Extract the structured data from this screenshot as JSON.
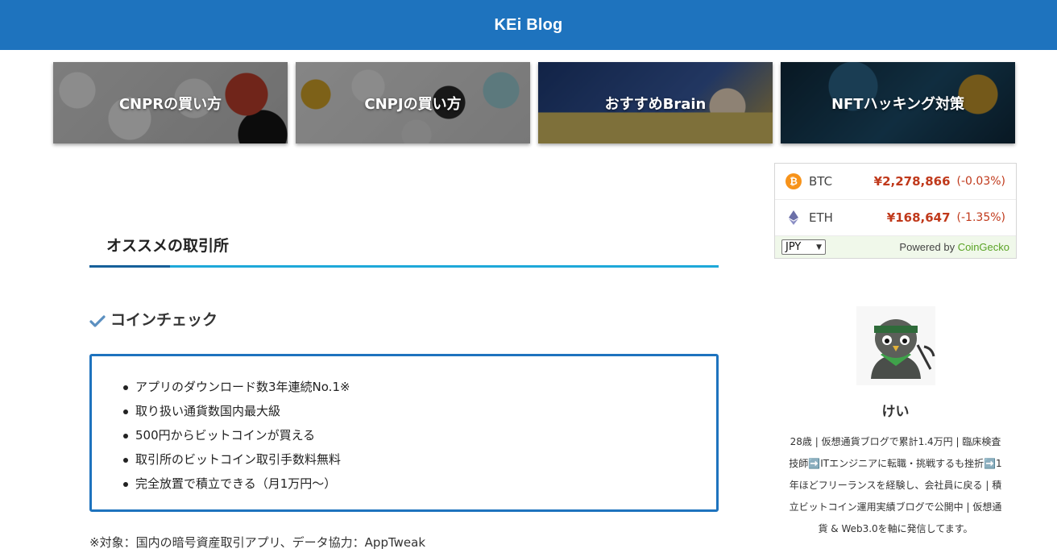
{
  "header": {
    "site_title": "KEi Blog"
  },
  "nav_cards": [
    {
      "label": "CNPRの買い方"
    },
    {
      "label": "CNPJの買い方"
    },
    {
      "label": "おすすめBrain"
    },
    {
      "label": "NFTハッキング対策"
    }
  ],
  "article": {
    "section_title": "オススメの取引所",
    "exchange_title": "コインチェック",
    "features": [
      "アプリのダウンロード数3年連続No.1※",
      "取り扱い通貨数国内最大級",
      "500円からビットコインが買える",
      "取引所のビットコイン取引手数料無料",
      "完全放置で積立できる（月1万円〜）"
    ],
    "note": "※対象：国内の暗号資産取引アプリ、データ協力：AppTweak"
  },
  "crypto_widget": {
    "coins": [
      {
        "icon": "bitcoin-icon",
        "symbol": "BTC",
        "price": "¥2,278,866",
        "change": "(-0.03%)"
      },
      {
        "icon": "ethereum-icon",
        "symbol": "ETH",
        "price": "¥168,647",
        "change": "(-1.35%)"
      }
    ],
    "currency": "JPY",
    "powered_by": "Powered by ",
    "powered_brand": "CoinGecko"
  },
  "profile": {
    "name": "けい",
    "bio": "28歳 | 仮想通貨ブログで累計1.4万円 | 臨床検査技師➡️ITエンジニアに転職・挑戦するも挫折➡️1年ほどフリーランスを経験し、会社員に戻る | 積立ビットコイン運用実績ブログで公開中 | 仮想通貨 & Web3.0を軸に発信してます。"
  },
  "colors": {
    "header_bg": "#1e73be",
    "accent_blue": "#1ea8d9",
    "price_red": "#c0391b",
    "coingecko_green": "#5aa325"
  }
}
